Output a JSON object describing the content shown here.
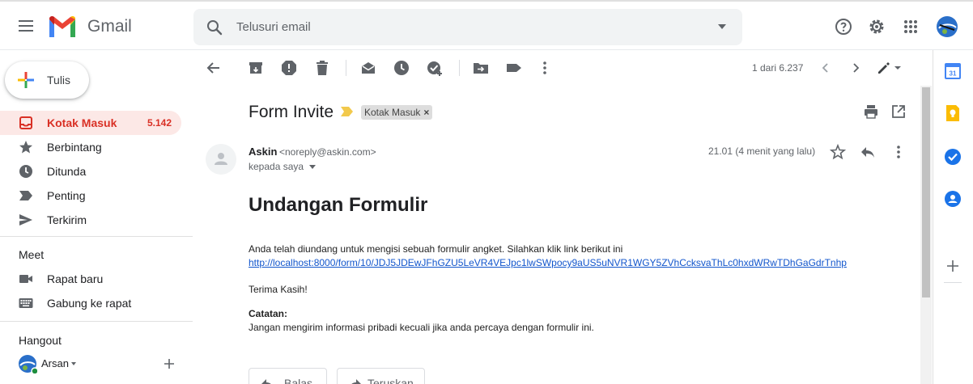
{
  "app": {
    "brand": "Gmail"
  },
  "search": {
    "placeholder": "Telusuri email"
  },
  "compose": {
    "label": "Tulis"
  },
  "nav": [
    {
      "label": "Kotak Masuk",
      "count": "5.142",
      "icon": "inbox-icon",
      "active": true
    },
    {
      "label": "Berbintang",
      "icon": "star-icon"
    },
    {
      "label": "Ditunda",
      "icon": "clock-icon"
    },
    {
      "label": "Penting",
      "icon": "label-important-icon"
    },
    {
      "label": "Terkirim",
      "icon": "send-icon"
    }
  ],
  "meet": {
    "title": "Meet",
    "items": [
      {
        "label": "Rapat baru",
        "icon": "video-icon"
      },
      {
        "label": "Gabung ke rapat",
        "icon": "keyboard-icon"
      }
    ]
  },
  "hangout": {
    "title": "Hangout",
    "user": "Arsan"
  },
  "toolbar": {
    "pager": "1 dari 6.237"
  },
  "email": {
    "subject": "Form Invite",
    "label": "Kotak Masuk",
    "sender_name": "Askin",
    "sender_email": "<noreply@askin.com>",
    "to": "kepada saya",
    "time": "21.01 (4 menit yang lalu)",
    "heading": "Undangan Formulir",
    "intro": "Anda telah diundang untuk mengisi sebuah formulir angket. Silahkan klik link berikut ini",
    "link": "http://localhost:8000/form/10/JDJ5JDEwJFhGZU5LeVR4VEJpc1lwSWpocy9aUS5uNVR1WGY5ZVhCcksvaThLc0hxdWRwTDhGaGdrTnhp",
    "thanks": "Terima Kasih!",
    "note_title": "Catatan:",
    "note": "Jangan mengirim informasi pribadi kecuali jika anda percaya dengan formulir ini."
  },
  "actions": {
    "reply": "Balas",
    "forward": "Teruskan"
  },
  "colors": {
    "accent": "#d93025",
    "active_bg": "#fce8e6",
    "link": "#1155cc"
  }
}
